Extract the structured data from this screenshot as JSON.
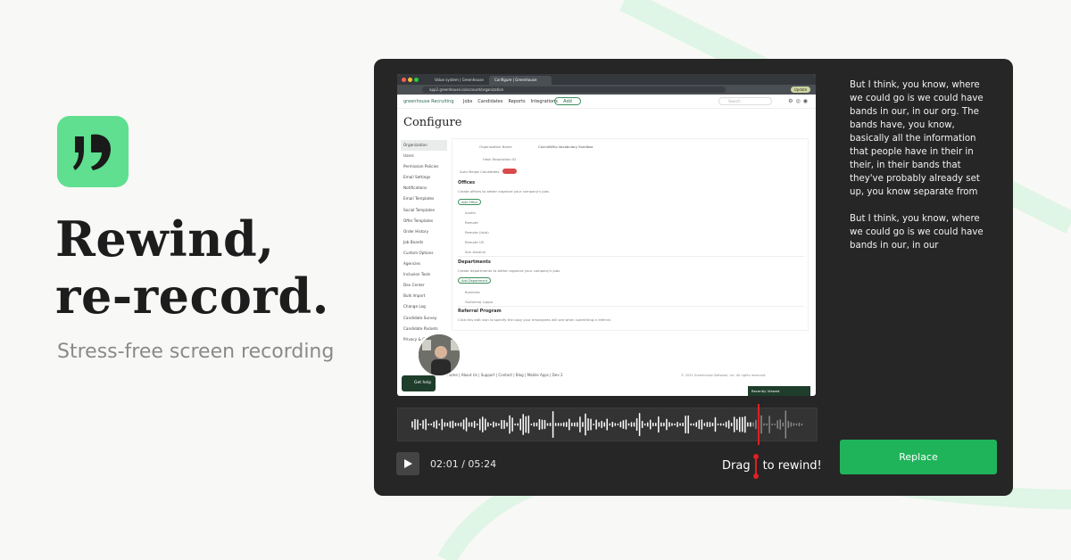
{
  "brand": {
    "logo_icon": "quote-logo-icon",
    "logo_color": "#5fdf8f",
    "headline_line1": "Rewind,",
    "headline_line2": "re-record.",
    "subheadline": "Stress-free screen recording"
  },
  "browser": {
    "tab1": "Value system | Greenhouse",
    "tab2": "Configure | Greenhouse",
    "url": "app2.greenhouse.io/account/organization",
    "update_label": "Update"
  },
  "greenhouse": {
    "brand": "greenhouse Recruiting",
    "nav": [
      "Jobs",
      "Candidates",
      "Reports",
      "Integrations"
    ],
    "add_label": "Add",
    "search_placeholder": "Search",
    "page_title": "Configure",
    "sidebar": [
      "Organization",
      "Users",
      "Permission Policies",
      "Email Settings",
      "Notifications",
      "Email Templates",
      "Social Templates",
      "Offer Templates",
      "Order History",
      "Job Boards",
      "Custom Options",
      "Agencies",
      "Inclusion Tools",
      "Dev Center",
      "Bulk Import",
      "Change Log",
      "Candidate Survey",
      "Candidate Packets",
      "Privacy & Compliance"
    ],
    "org_name_label": "Organization Name",
    "org_name_value": "ConnieWho Vocabulary Sandbox",
    "hash_label": "Hash Requisition ID",
    "auto_merge_label": "Auto Merge Candidates",
    "toggle_label": "Off",
    "offices_title": "Offices",
    "offices_desc": "Create offices to better organize your company's jobs",
    "add_office": "Add Office",
    "offices": [
      "Austin",
      "Remote",
      "Remote (Asia)",
      "Remote US",
      "San Antonio"
    ],
    "departments_title": "Departments",
    "departments_desc": "Create departments to better organize your company's jobs",
    "add_department": "Add Department",
    "departments": [
      "Business",
      "Guillermo Luppo"
    ],
    "referral_title": "Referral Program",
    "referral_desc": "Click this edit icon to specify the copy your employees will see when submitting a referral.",
    "footer_links": "Home | About Us | Support | Contact | Blog | Mobile Apps | Dev 2",
    "copyright": "© 2023 Greenhouse Software, Inc. All rights reserved.",
    "recently_viewed": "Recently Viewed",
    "get_help": "Get help"
  },
  "player": {
    "time": "02:01 / 05:24",
    "drag_word": "Drag",
    "rewind_text": "to rewind!",
    "played_color": "#ffffff",
    "unplayed_color": "#8a8a8a",
    "playhead_color": "#e02020"
  },
  "transcript": {
    "para1": "But I think, you know, where we could go is we could have bands in our, in our org. The bands have, you know, basically all the information that people have in their in their, in their bands that they've probably already set up, you know separate from",
    "para2": "But I think, you know, where we could go is we could have bands in our, in our"
  },
  "actions": {
    "replace_label": "Replace",
    "replace_color": "#1fb45a"
  }
}
